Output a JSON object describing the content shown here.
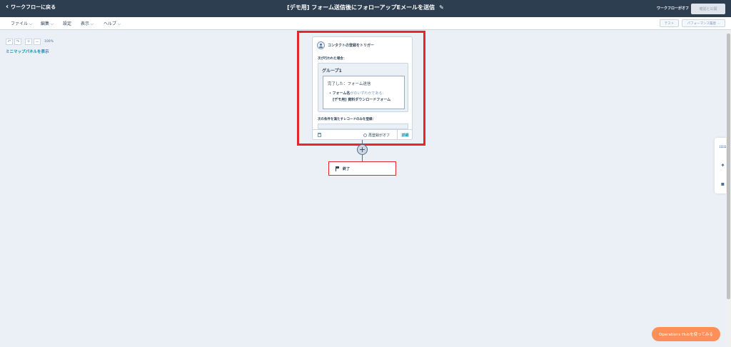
{
  "topbar": {
    "back_label": "ワークフローに戻る",
    "title": "[デモ用] フォーム送信後にフォローアップEメールを送信",
    "status": "ワークフローがオフ",
    "publish_label": "確認と公開"
  },
  "menubar": {
    "items": [
      {
        "label": "ファイル",
        "caret": true
      },
      {
        "label": "編集",
        "caret": true
      },
      {
        "label": "設定",
        "caret": false
      },
      {
        "label": "表示",
        "caret": true
      },
      {
        "label": "ヘルプ",
        "caret": true
      }
    ],
    "test_label": "テスト",
    "performance_label": "パフォーマンス履歴"
  },
  "canvas": {
    "zoom_level": "100%",
    "minimap_link": "ミニマップパネルを表示"
  },
  "trigger": {
    "header": "コンタクトの登録をトリガー",
    "when_label": "次が行われた場合：",
    "group_title": "グループ1",
    "filter_title": "完了した：フォーム送信",
    "filter_field": "フォーム名",
    "filter_op": "がのいずれかである：",
    "filter_value": "[デモ用] 資料ダウンロードフォーム",
    "condition_label": "次の条件を満たすレコードのみを登録：",
    "reenroll_label": "再登録がオフ",
    "details_label": "詳細"
  },
  "end_node": {
    "label": "終了"
  },
  "ops_button": "Operations Hubを使ってみる",
  "colors": {
    "topbar": "#2d3e50",
    "canvas": "#eaf0f6",
    "highlight": "#e8252b",
    "link": "#0091ae",
    "ops_button": "#ff8f59"
  }
}
